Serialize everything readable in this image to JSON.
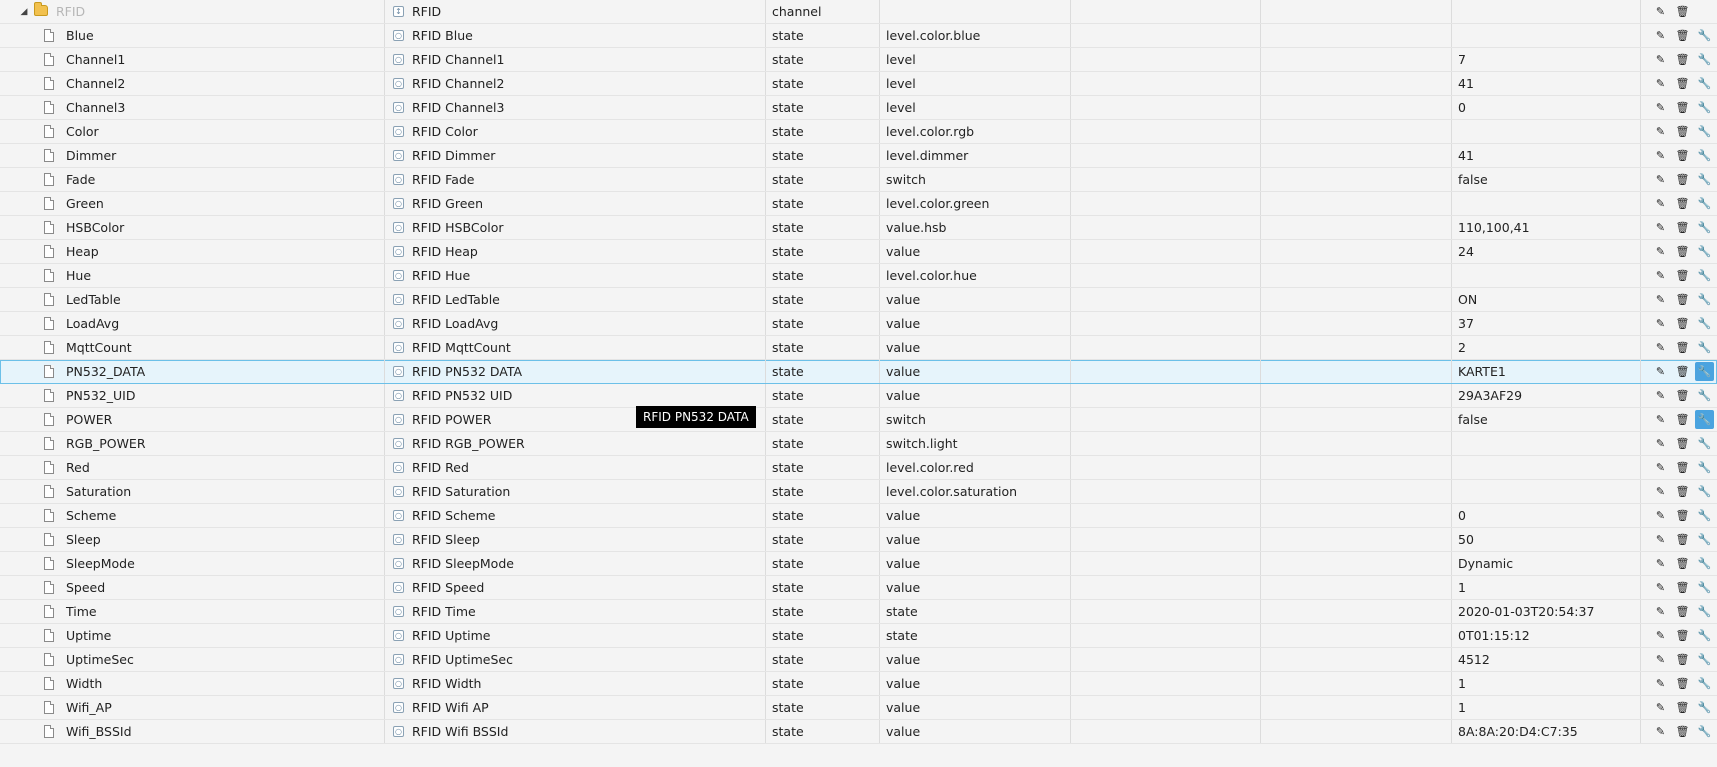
{
  "tooltip": "RFID PN532  DATA",
  "icons": {
    "folder": "folder-icon",
    "file": "file-icon",
    "state": "state-icon",
    "channel": "channel-icon",
    "edit": "pencil-icon",
    "delete": "trash-icon",
    "settings": "wrench-icon"
  },
  "colors": {
    "accent": "#4aa3df",
    "selected_bg": "#e6f4fb",
    "folder": "#f2c14e"
  },
  "rows": [
    {
      "id": "RFID",
      "name": "RFID",
      "type": "channel",
      "role": "",
      "value": "",
      "kind": "channel"
    },
    {
      "id": "Blue",
      "name": "RFID Blue",
      "type": "state",
      "role": "level.color.blue",
      "value": ""
    },
    {
      "id": "Channel1",
      "name": "RFID Channel1",
      "type": "state",
      "role": "level",
      "value": "7"
    },
    {
      "id": "Channel2",
      "name": "RFID Channel2",
      "type": "state",
      "role": "level",
      "value": "41"
    },
    {
      "id": "Channel3",
      "name": "RFID Channel3",
      "type": "state",
      "role": "level",
      "value": "0"
    },
    {
      "id": "Color",
      "name": "RFID Color",
      "type": "state",
      "role": "level.color.rgb",
      "value": ""
    },
    {
      "id": "Dimmer",
      "name": "RFID Dimmer",
      "type": "state",
      "role": "level.dimmer",
      "value": "41"
    },
    {
      "id": "Fade",
      "name": "RFID Fade",
      "type": "state",
      "role": "switch",
      "value": "false"
    },
    {
      "id": "Green",
      "name": "RFID Green",
      "type": "state",
      "role": "level.color.green",
      "value": ""
    },
    {
      "id": "HSBColor",
      "name": "RFID HSBColor",
      "type": "state",
      "role": "value.hsb",
      "value": "110,100,41"
    },
    {
      "id": "Heap",
      "name": "RFID Heap",
      "type": "state",
      "role": "value",
      "value": "24"
    },
    {
      "id": "Hue",
      "name": "RFID Hue",
      "type": "state",
      "role": "level.color.hue",
      "value": ""
    },
    {
      "id": "LedTable",
      "name": "RFID LedTable",
      "type": "state",
      "role": "value",
      "value": "ON"
    },
    {
      "id": "LoadAvg",
      "name": "RFID LoadAvg",
      "type": "state",
      "role": "value",
      "value": "37"
    },
    {
      "id": "MqttCount",
      "name": "RFID MqttCount",
      "type": "state",
      "role": "value",
      "value": "2"
    },
    {
      "id": "PN532_DATA",
      "name": "RFID PN532 DATA",
      "type": "state",
      "role": "value",
      "value": "KARTE1",
      "selected": true,
      "active_tool": true
    },
    {
      "id": "PN532_UID",
      "name": "RFID PN532 UID",
      "type": "state",
      "role": "value",
      "value": "29A3AF29"
    },
    {
      "id": "POWER",
      "name": "RFID POWER",
      "type": "state",
      "role": "switch",
      "value": "false",
      "active_tool": true
    },
    {
      "id": "RGB_POWER",
      "name": "RFID RGB_POWER",
      "type": "state",
      "role": "switch.light",
      "value": ""
    },
    {
      "id": "Red",
      "name": "RFID Red",
      "type": "state",
      "role": "level.color.red",
      "value": ""
    },
    {
      "id": "Saturation",
      "name": "RFID Saturation",
      "type": "state",
      "role": "level.color.saturation",
      "value": ""
    },
    {
      "id": "Scheme",
      "name": "RFID Scheme",
      "type": "state",
      "role": "value",
      "value": "0"
    },
    {
      "id": "Sleep",
      "name": "RFID Sleep",
      "type": "state",
      "role": "value",
      "value": "50"
    },
    {
      "id": "SleepMode",
      "name": "RFID SleepMode",
      "type": "state",
      "role": "value",
      "value": "Dynamic"
    },
    {
      "id": "Speed",
      "name": "RFID Speed",
      "type": "state",
      "role": "value",
      "value": "1"
    },
    {
      "id": "Time",
      "name": "RFID Time",
      "type": "state",
      "role": "state",
      "value": "2020-01-03T20:54:37"
    },
    {
      "id": "Uptime",
      "name": "RFID Uptime",
      "type": "state",
      "role": "state",
      "value": "0T01:15:12"
    },
    {
      "id": "UptimeSec",
      "name": "RFID UptimeSec",
      "type": "state",
      "role": "value",
      "value": "4512"
    },
    {
      "id": "Width",
      "name": "RFID Width",
      "type": "state",
      "role": "value",
      "value": "1"
    },
    {
      "id": "Wifi_AP",
      "name": "RFID Wifi AP",
      "type": "state",
      "role": "value",
      "value": "1"
    },
    {
      "id": "Wifi_BSSId",
      "name": "RFID Wifi BSSId",
      "type": "state",
      "role": "value",
      "value": "8A:8A:20:D4:C7:35"
    }
  ]
}
